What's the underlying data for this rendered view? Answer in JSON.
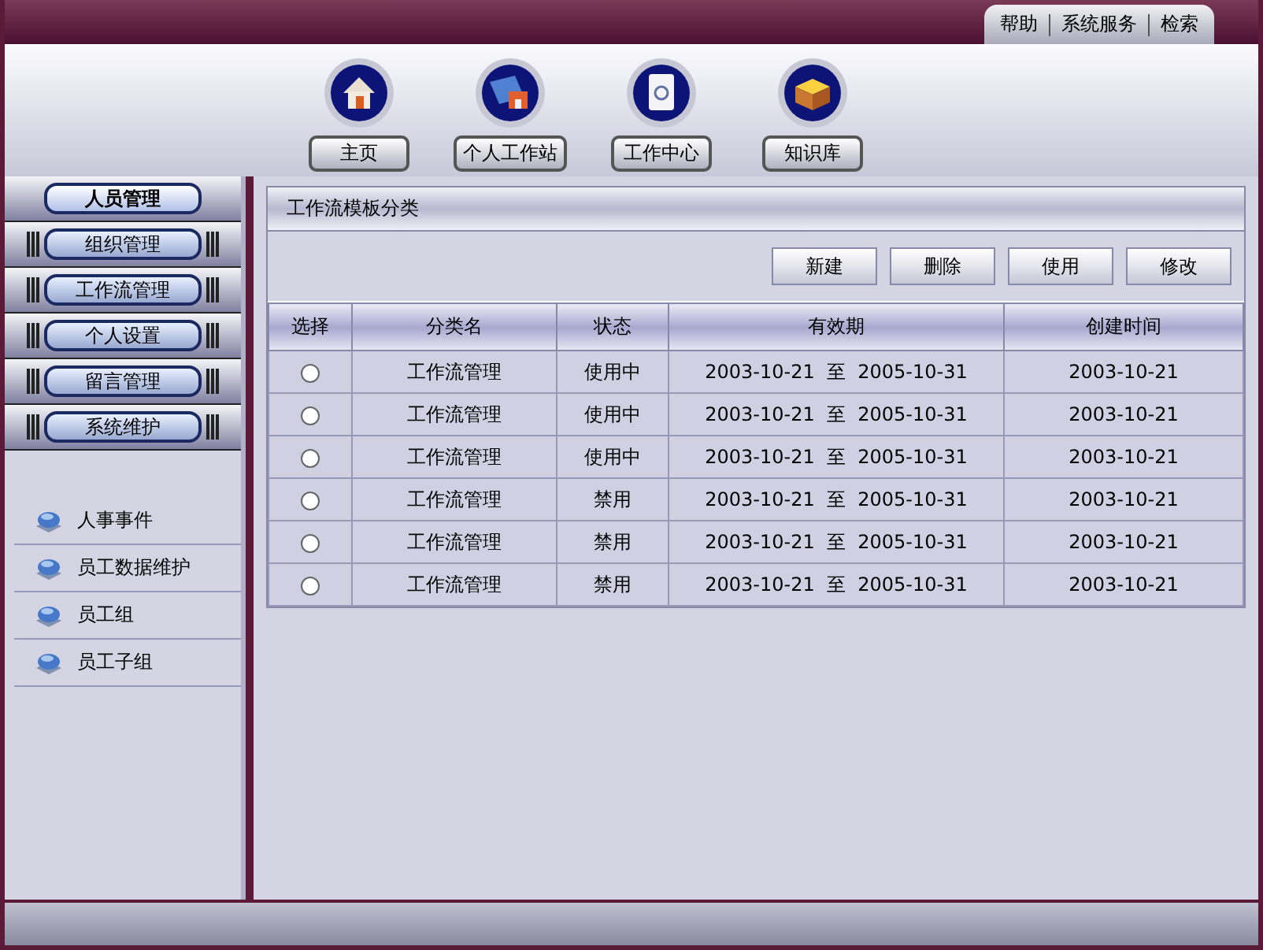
{
  "top_links": [
    "帮助",
    "系统服务",
    "检索"
  ],
  "nav": [
    {
      "label": "主页",
      "kind": "home"
    },
    {
      "label": "个人工作站",
      "kind": "folder"
    },
    {
      "label": "工作中心",
      "kind": "notebook"
    },
    {
      "label": "知识库",
      "kind": "box"
    }
  ],
  "sidebar": {
    "menu": [
      {
        "label": "人员管理",
        "selected": true
      },
      {
        "label": "组织管理",
        "selected": false
      },
      {
        "label": "工作流管理",
        "selected": false
      },
      {
        "label": "个人设置",
        "selected": false
      },
      {
        "label": "留言管理",
        "selected": false
      },
      {
        "label": "系统维护",
        "selected": false
      }
    ],
    "items": [
      "人事事件",
      "员工数据维护",
      "员工组",
      "员工子组"
    ]
  },
  "panel": {
    "title": "工作流模板分类",
    "buttons": [
      "新建",
      "删除",
      "使用",
      "修改"
    ]
  },
  "table": {
    "columns": [
      "选择",
      "分类名",
      "状态",
      "有效期",
      "创建时间"
    ],
    "rows": [
      {
        "selected": false,
        "name": "工作流管理",
        "status": "使用中",
        "from": "2003-10-21",
        "sep": "至",
        "to": "2005-10-31",
        "created": "2003-10-21"
      },
      {
        "selected": false,
        "name": "工作流管理",
        "status": "使用中",
        "from": "2003-10-21",
        "sep": "至",
        "to": "2005-10-31",
        "created": "2003-10-21"
      },
      {
        "selected": false,
        "name": "工作流管理",
        "status": "使用中",
        "from": "2003-10-21",
        "sep": "至",
        "to": "2005-10-31",
        "created": "2003-10-21"
      },
      {
        "selected": false,
        "name": "工作流管理",
        "status": "禁用",
        "from": "2003-10-21",
        "sep": "至",
        "to": "2005-10-31",
        "created": "2003-10-21"
      },
      {
        "selected": false,
        "name": "工作流管理",
        "status": "禁用",
        "from": "2003-10-21",
        "sep": "至",
        "to": "2005-10-31",
        "created": "2003-10-21"
      },
      {
        "selected": false,
        "name": "工作流管理",
        "status": "禁用",
        "from": "2003-10-21",
        "sep": "至",
        "to": "2005-10-31",
        "created": "2003-10-21"
      }
    ]
  }
}
